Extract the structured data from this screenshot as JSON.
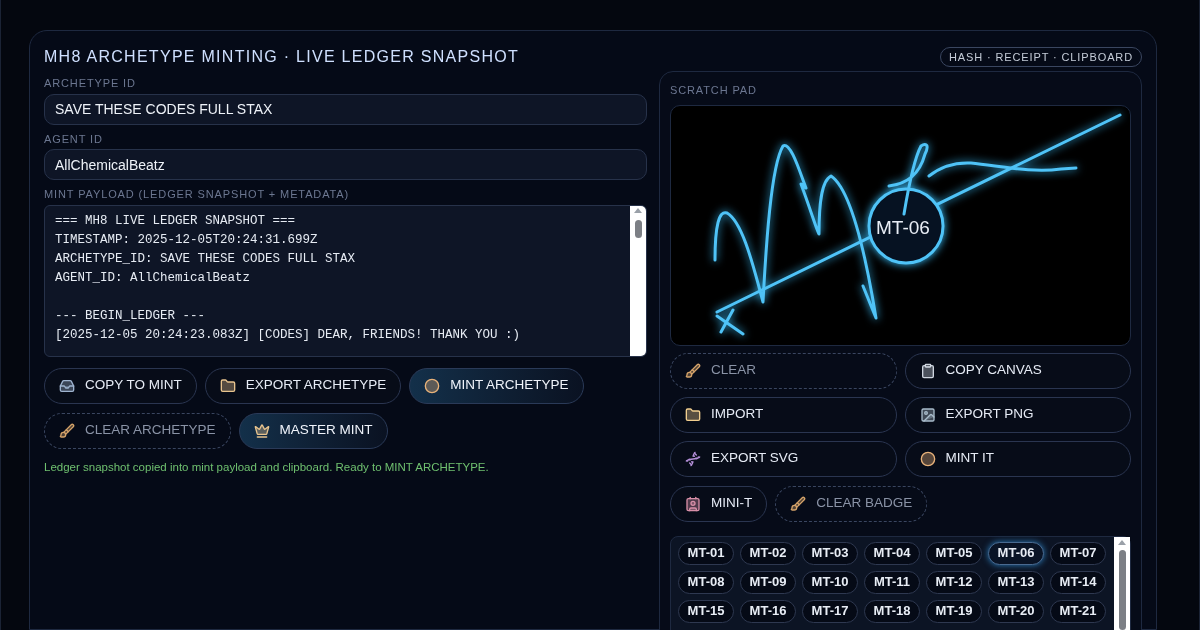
{
  "header": {
    "title": "MH8 ARCHETYPE MINTING · LIVE LEDGER SNAPSHOT",
    "tag": "HASH · RECEIPT · CLIPBOARD"
  },
  "fields": [
    {
      "label": "ARCHETYPE ID",
      "value": "SAVE THESE CODES FULL STAX"
    },
    {
      "label": "AGENT ID",
      "value": "AllChemicalBeatz"
    }
  ],
  "payload": {
    "label": "MINT PAYLOAD (LEDGER SNAPSHOT + METADATA)",
    "value": "=== MH8 LIVE LEDGER SNAPSHOT ===\nTIMESTAMP: 2025-12-05T20:24:31.699Z\nARCHETYPE_ID: SAVE THESE CODES FULL STAX\nAGENT_ID: AllChemicalBeatz\n\n--- BEGIN_LEDGER ---\n[2025-12-05 20:24:23.083Z] [CODES] DEAR, FRIENDS! THANK YOU :)"
  },
  "actions": [
    {
      "label": "COPY TO MINT",
      "kind": "default"
    },
    {
      "label": "EXPORT ARCHETYPE",
      "kind": "default"
    },
    {
      "label": "MINT ARCHETYPE",
      "kind": "primary"
    },
    {
      "label": "CLEAR ARCHETYPE",
      "kind": "ghost"
    },
    {
      "label": "MASTER MINT",
      "kind": "primary"
    }
  ],
  "status": "Ledger snapshot copied into mint payload and clipboard. Ready to MINT ARCHETYPE.",
  "scratch_pad": {
    "label": "SCRATCH PAD",
    "stamp": "MT-06",
    "buttons": [
      {
        "label": "CLEAR",
        "kind": "ghost"
      },
      {
        "label": "COPY CANVAS",
        "kind": "default"
      },
      {
        "label": "IMPORT",
        "kind": "default"
      },
      {
        "label": "EXPORT PNG",
        "kind": "default"
      },
      {
        "label": "EXPORT SVG",
        "kind": "default"
      },
      {
        "label": "MINT IT",
        "kind": "default"
      }
    ],
    "small_buttons": [
      {
        "label": "MINI-T",
        "kind": "default"
      },
      {
        "label": "CLEAR BADGE",
        "kind": "ghost"
      }
    ],
    "badges": [
      {
        "label": "MT-01",
        "selected": false
      },
      {
        "label": "MT-02",
        "selected": false
      },
      {
        "label": "MT-03",
        "selected": false
      },
      {
        "label": "MT-04",
        "selected": false
      },
      {
        "label": "MT-05",
        "selected": false
      },
      {
        "label": "MT-06",
        "selected": true
      },
      {
        "label": "MT-07",
        "selected": false
      },
      {
        "label": "MT-08",
        "selected": false
      },
      {
        "label": "MT-09",
        "selected": false
      },
      {
        "label": "MT-10",
        "selected": false
      },
      {
        "label": "MT-11",
        "selected": false
      },
      {
        "label": "MT-12",
        "selected": false
      },
      {
        "label": "MT-13",
        "selected": false
      },
      {
        "label": "MT-14",
        "selected": false
      },
      {
        "label": "MT-15",
        "selected": false
      },
      {
        "label": "MT-16",
        "selected": false
      },
      {
        "label": "MT-17",
        "selected": false
      },
      {
        "label": "MT-18",
        "selected": false
      },
      {
        "label": "MT-19",
        "selected": false
      },
      {
        "label": "MT-20",
        "selected": false
      },
      {
        "label": "MT-21",
        "selected": false
      }
    ]
  }
}
